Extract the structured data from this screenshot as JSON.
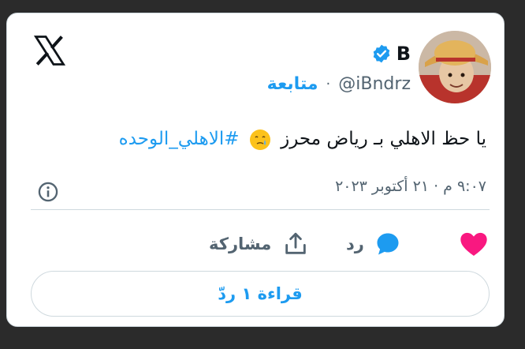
{
  "author": {
    "display_name": "B",
    "handle": "@iBndrz",
    "follow_label": "متابعة",
    "separator": "·"
  },
  "tweet": {
    "text_before": "يا حظ الاهلي بـ رياض محرز",
    "hashtag": "#الاهلي_الوحده",
    "timestamp": "٩:٠٧ م · ٢١ أكتوبر ٢٠٢٣"
  },
  "actions": {
    "reply_label": "رد",
    "share_label": "مشاركة"
  },
  "read_replies_label": "قراءة ١ ردّ",
  "colors": {
    "accent": "#1d9bf0",
    "like": "#f91880",
    "text": "#0f1419",
    "muted": "#536471"
  },
  "icons": [
    "x-logo-icon",
    "verified-icon",
    "info-icon",
    "heart-icon",
    "reply-bubble-icon",
    "share-icon",
    "emoji-face-icon"
  ]
}
